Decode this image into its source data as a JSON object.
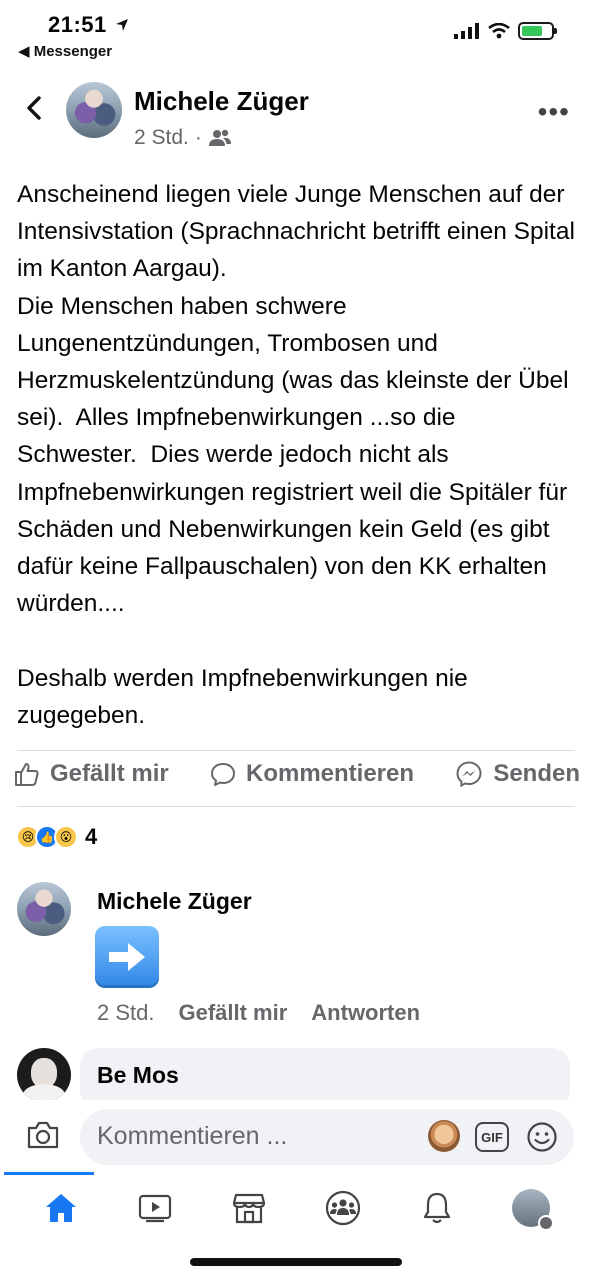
{
  "status_bar": {
    "time": "21:51",
    "back_app": "Messenger"
  },
  "post": {
    "author": "Michele Züger",
    "time": "2 Std.",
    "body": "Anscheinend liegen viele Junge Menschen auf der Intensivstation (Sprachnachricht betrifft einen Spital im Kanton Aargau).\nDie Menschen haben schwere Lungenentzündungen, Trombosen und Herzmuskelentzündung (was das kleinste der Übel sei).  Alles Impfnebenwirkungen ...so die Schwester.  Dies werde jedoch nicht als Impfnebenwirkungen registriert weil die Spitäler für Schäden und Nebenwirkungen kein Geld (es gibt dafür keine Fallpauschalen) von den KK erhalten würden....\n\nDeshalb werden Impfnebenwirkungen nie zugegeben."
  },
  "actions": {
    "like": "Gefällt mir",
    "comment": "Kommentieren",
    "send": "Senden"
  },
  "reactions": {
    "count": "4",
    "types": [
      "sad",
      "like",
      "wow"
    ]
  },
  "comments": [
    {
      "author": "Michele Züger",
      "content_icon": "right-arrow-emoji",
      "time": "2 Std.",
      "like": "Gefällt mir",
      "reply": "Antworten"
    },
    {
      "author": "Be Mos"
    }
  ],
  "composer": {
    "placeholder": "Kommentieren ...",
    "gif": "GIF"
  },
  "tabs": [
    "home",
    "watch",
    "marketplace",
    "groups",
    "notifications",
    "menu"
  ],
  "colors": {
    "accent": "#1877f2",
    "secondary_text": "#65676b",
    "bubble": "#f0f2f5"
  }
}
